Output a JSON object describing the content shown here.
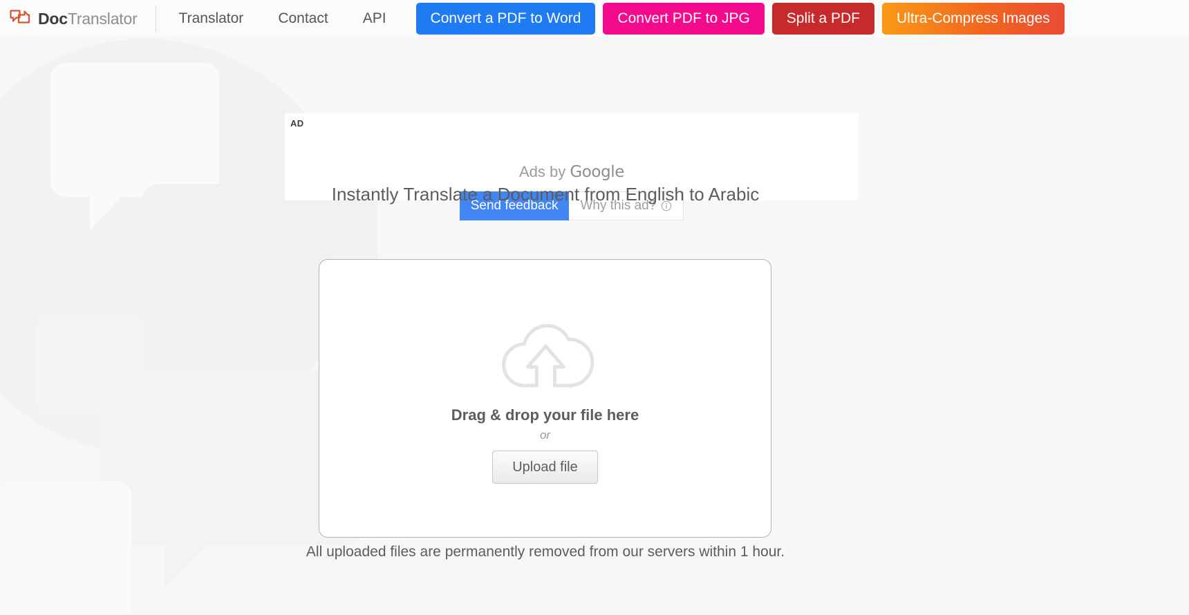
{
  "nav": {
    "brand": {
      "bold": "Doc",
      "rest": "Translator",
      "icon": "speech-bubbles-logo-icon"
    },
    "links": [
      {
        "label": "Translator",
        "name": "nav-link-translator"
      },
      {
        "label": "Contact",
        "name": "nav-link-contact"
      },
      {
        "label": "API",
        "name": "nav-link-api"
      }
    ],
    "ctas": [
      {
        "label": "Convert a PDF to Word",
        "name": "cta-convert-pdf-to-word",
        "color": "#1f7bf4"
      },
      {
        "label": "Convert PDF to JPG",
        "name": "cta-convert-pdf-to-jpg",
        "color": "#f40a8c"
      },
      {
        "label": "Split a PDF",
        "name": "cta-split-a-pdf",
        "color": "#c62a2a"
      },
      {
        "label": "Ultra-Compress Images",
        "name": "cta-ultra-compress-images",
        "color": "#f2661f"
      }
    ]
  },
  "ad": {
    "badge": "AD",
    "ads_by_prefix": "Ads by ",
    "ads_by_brand": "Google",
    "send_feedback_label": "Send feedback",
    "why_this_ad_label": "Why this ad?",
    "info_icon": "info-circle-icon"
  },
  "main": {
    "headline": "Instantly Translate a Document from English to Arabic",
    "dropzone": {
      "icon": "cloud-upload-icon",
      "drag_label": "Drag & drop your file here",
      "or_label": "or",
      "upload_button_label": "Upload file"
    },
    "privacy_note": "All uploaded files are permanently removed from our servers within 1 hour."
  },
  "colors": {
    "brand_orange": "#d85434",
    "page_background": "#f7f7f7",
    "accent_blue": "#4285f4"
  }
}
